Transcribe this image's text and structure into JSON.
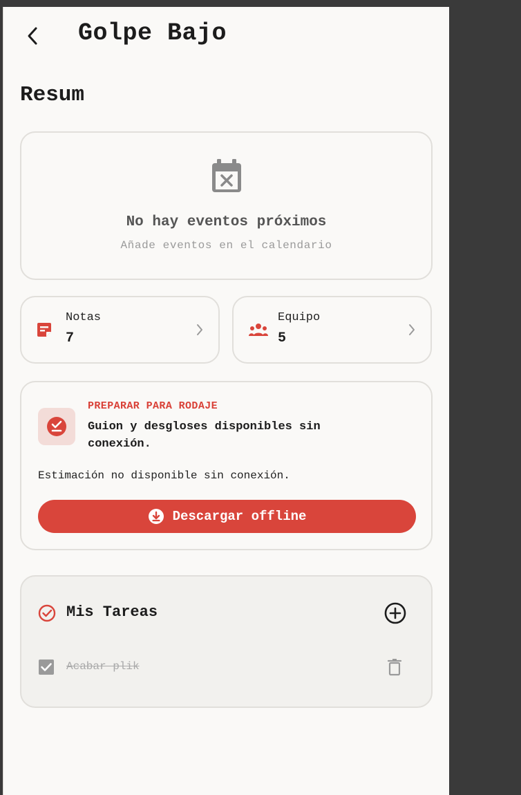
{
  "header": {
    "title": "Golpe Bajo",
    "back_icon": "chevron-left-icon"
  },
  "section_title": "Resum",
  "events": {
    "icon": "calendar-remove-icon",
    "title": "No hay eventos próximos",
    "subtitle": "Añade eventos en el calendario"
  },
  "stats": [
    {
      "label": "Notas",
      "value": "7",
      "icon": "note-icon"
    },
    {
      "label": "Equipo",
      "value": "5",
      "icon": "group-icon"
    }
  ],
  "prepare": {
    "eyebrow": "PREPARAR PARA RODAJE",
    "message": "Guion y desgloses disponibles sin conexión.",
    "note": "Estimación no disponible sin conexión.",
    "button_label": "Descargar offline"
  },
  "tasks": {
    "title": "Mis Tareas",
    "items": [
      {
        "label": "Acabar plik",
        "done": true
      }
    ]
  },
  "colors": {
    "accent": "#d9453b",
    "background": "#faf9f7",
    "muted": "#9a9a9a"
  }
}
